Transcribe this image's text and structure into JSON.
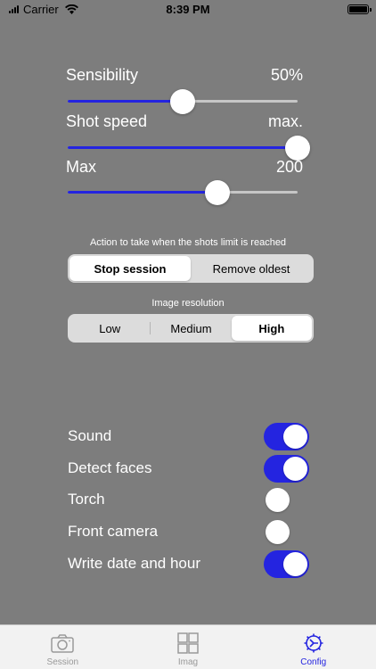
{
  "status_bar": {
    "carrier": "Carrier",
    "time": "8:39 PM"
  },
  "sliders": [
    {
      "label": "Sensibility",
      "value_text": "50%",
      "fraction": 0.5
    },
    {
      "label": "Shot speed",
      "value_text": "max.",
      "fraction": 1.0
    },
    {
      "label": "Max",
      "value_text": "200",
      "fraction": 0.65
    }
  ],
  "limit_action": {
    "caption": "Action to take when the shots limit is reached",
    "options": [
      "Stop session",
      "Remove oldest"
    ],
    "selected": "Stop session"
  },
  "resolution": {
    "caption": "Image resolution",
    "options": [
      "Low",
      "Medium",
      "High"
    ],
    "selected": "High"
  },
  "toggles": [
    {
      "label": "Sound",
      "on": true
    },
    {
      "label": "Detect faces",
      "on": true
    },
    {
      "label": "Torch",
      "on": false
    },
    {
      "label": "Front camera",
      "on": false
    },
    {
      "label": "Write date and hour",
      "on": true
    }
  ],
  "tab_bar": {
    "tabs": [
      {
        "label": "Session",
        "icon": "camera-icon",
        "active": false
      },
      {
        "label": "Imag",
        "icon": "grid-icon",
        "active": false
      },
      {
        "label": "Config",
        "icon": "gear-icon",
        "active": true
      }
    ]
  },
  "colors": {
    "accent": "#2424e0",
    "background": "#7d7d7d"
  }
}
